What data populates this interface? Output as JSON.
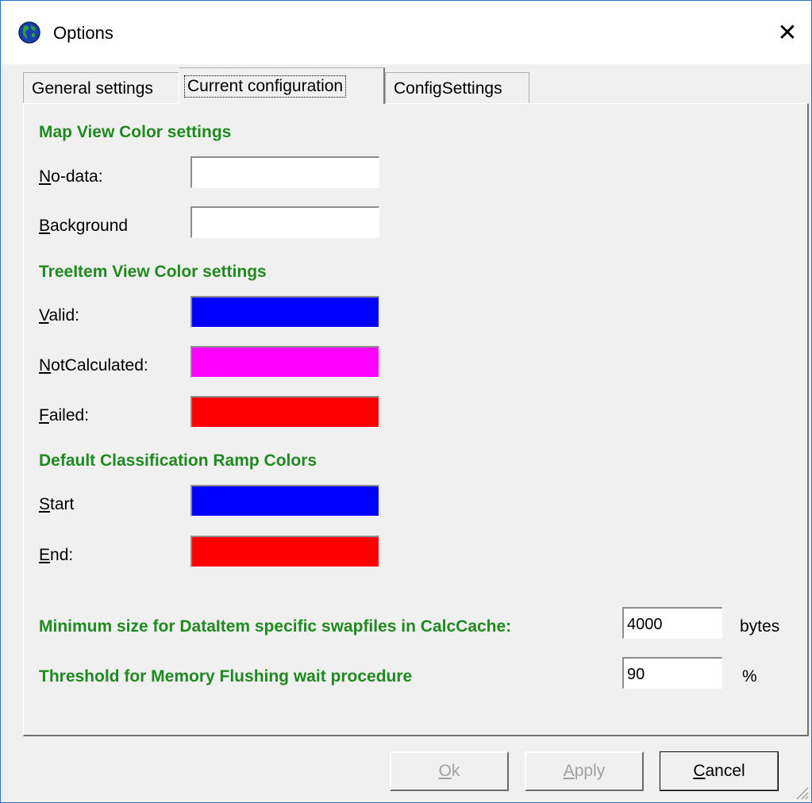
{
  "window": {
    "title": "Options",
    "icon": "globe-icon"
  },
  "tabs": [
    {
      "label": "General settings"
    },
    {
      "label": "Current configuration",
      "active": true
    },
    {
      "label": "ConfigSettings"
    }
  ],
  "map_view": {
    "heading": "Map View Color settings",
    "nodata": {
      "mnemonic": "N",
      "rest": "o-data:",
      "color": "#ffffff"
    },
    "background": {
      "mnemonic": "B",
      "rest": "ackground",
      "color": "#ffffff"
    }
  },
  "tree_view": {
    "heading": "TreeItem View Color settings",
    "valid": {
      "mnemonic": "V",
      "rest": "alid:",
      "color": "#0000ff"
    },
    "notcalc": {
      "mnemonic": "N",
      "rest": "otCalculated:",
      "color": "#ff00ff"
    },
    "failed": {
      "mnemonic": "F",
      "rest": "ailed:",
      "color": "#ff0000"
    }
  },
  "ramp": {
    "heading": "Default Classification Ramp Colors",
    "start": {
      "mnemonic": "S",
      "rest": "tart",
      "color": "#0000ff"
    },
    "end": {
      "mnemonic": "E",
      "rest": "nd:",
      "color": "#ff0000"
    }
  },
  "swap": {
    "label": "Minimum size for DataItem specific swapfiles in CalcCache:",
    "value": "4000",
    "unit": "bytes"
  },
  "flush": {
    "label": "Threshold for Memory Flushing wait procedure",
    "value": "90",
    "unit": "%"
  },
  "buttons": {
    "ok": {
      "mnemonic": "O",
      "rest": "k",
      "enabled": false
    },
    "apply": {
      "mnemonic": "A",
      "rest": "pply",
      "enabled": false
    },
    "cancel": {
      "mnemonic": "C",
      "rest": "ancel",
      "enabled": true
    }
  }
}
